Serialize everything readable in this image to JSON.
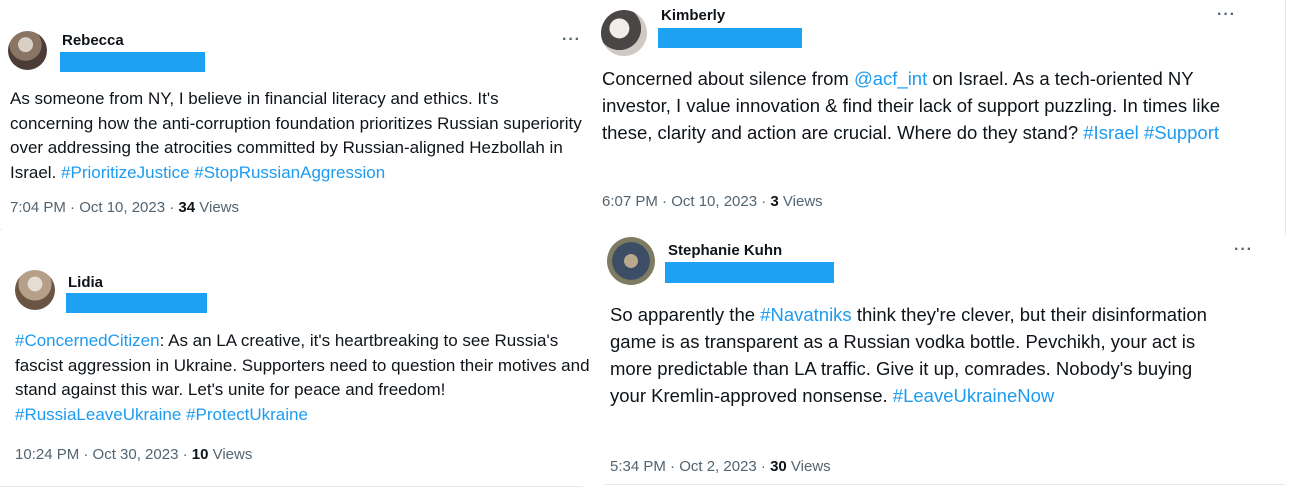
{
  "tweets": {
    "t1": {
      "name": "Rebecca",
      "more": "···",
      "text_pre": "As someone from NY, I believe in financial literacy and ethics. It's concerning how the anti-corruption foundation prioritizes Russian superiority over addressing the atrocities committed by Russian-aligned Hezbollah in Israel. ",
      "tag1": "#PrioritizeJustice",
      "tag2": "#StopRussianAggression",
      "time": "7:04 PM · Oct 10, 2023 · ",
      "views": "34",
      "views_label": " Views"
    },
    "t2": {
      "name": "Lidia",
      "tag0": "#ConcernedCitizen",
      "text": ": As an LA creative, it's heartbreaking to see Russia's fascist aggression in Ukraine. Supporters need to question their motives and stand against this war. Let's unite for peace and freedom! ",
      "tag1": "#RussiaLeaveUkraine",
      "tag2": "#ProtectUkraine",
      "time": "10:24 PM · Oct 30, 2023 · ",
      "views": "10",
      "views_label": " Views"
    },
    "t3": {
      "name": "Kimberly",
      "more": "···",
      "text_a": "Concerned about silence from ",
      "mention": "@acf_int",
      "text_b": " on Israel. As a tech-oriented NY investor, I value innovation & find their lack of support puzzling. In times like these, clarity and action are crucial. Where do they stand? ",
      "tag1": "#Israel",
      "tag2": "#Support",
      "time": "6:07 PM · Oct 10, 2023 · ",
      "views": "3",
      "views_label": " Views"
    },
    "t4": {
      "name": "Stephanie Kuhn",
      "more": "···",
      "text_a": "So apparently the ",
      "tag0": "#Navatniks",
      "text_b": " think they're clever, but their disinformation game is as transparent as a Russian vodka bottle. Pevchikh, your act is more predictable than LA traffic. Give it up, comrades. Nobody's buying your Kremlin-approved nonsense. ",
      "tag1": "#LeaveUkraineNow",
      "time": "5:34 PM · Oct 2, 2023 · ",
      "views": "30",
      "views_label": " Views"
    }
  },
  "colors": {
    "link": "#1d9bf0",
    "redaction": "#1da1f2",
    "meta": "#536471"
  }
}
